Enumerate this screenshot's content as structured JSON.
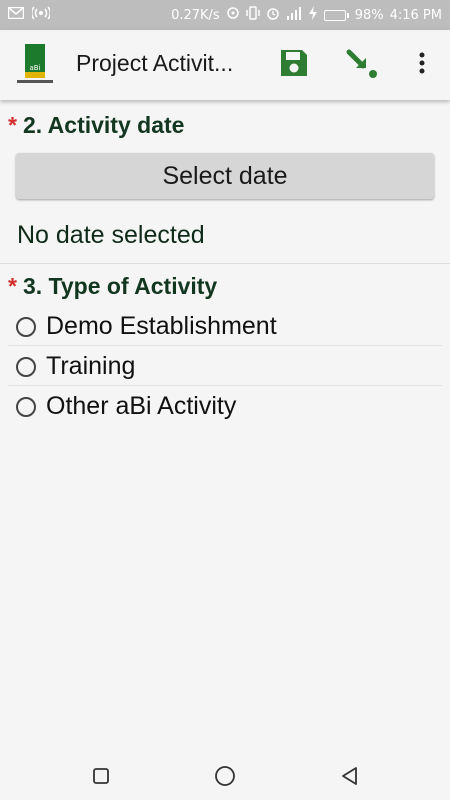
{
  "status_bar": {
    "speed": "0.27K/s",
    "battery": "98%",
    "time": "4:16 PM",
    "icons": [
      "mail-icon",
      "wireless-icon",
      "hotspot-icon",
      "vibrate-icon",
      "alarm-icon",
      "signal-icon",
      "charging-icon",
      "battery-icon"
    ]
  },
  "app_bar": {
    "title": "Project Activit...",
    "logo_text": "aBi",
    "actions": [
      "save-icon",
      "finalize-icon",
      "more-vertical-icon"
    ],
    "accent": "#2e7d32"
  },
  "questions": [
    {
      "required_mark": "*",
      "label": "2. Activity date",
      "button_label": "Select date",
      "value_text": "No date selected"
    },
    {
      "required_mark": "*",
      "label": "3. Type of Activity",
      "options": [
        "Demo Establishment",
        "Training",
        "Other aBi Activity"
      ],
      "selected": null
    }
  ],
  "nav_bar": {
    "icons": [
      "recent-apps-icon",
      "home-icon",
      "back-icon"
    ]
  },
  "colors": {
    "required": "#d32f2f",
    "label": "#12361f",
    "button_bg": "#d6d6d6"
  }
}
